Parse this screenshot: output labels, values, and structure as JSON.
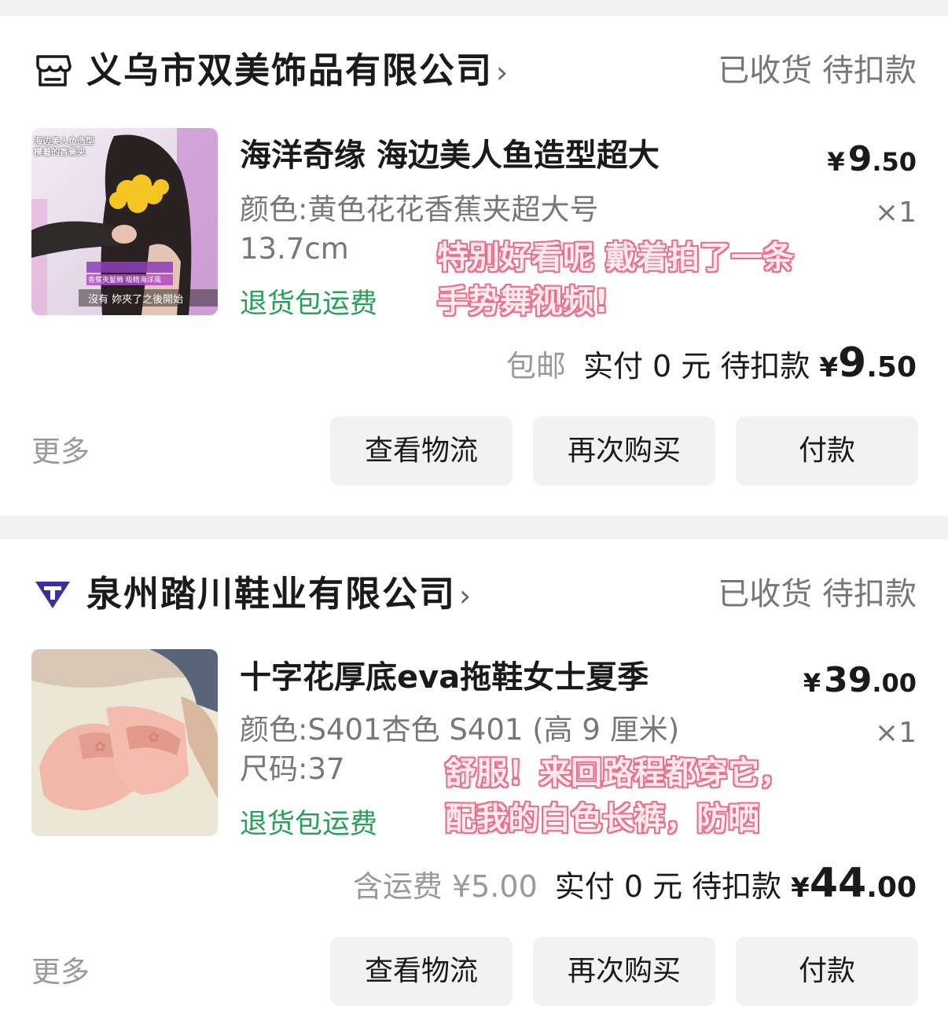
{
  "orders": [
    {
      "shop_name": "义乌市双美饰品有限公司",
      "shop_chevron": "›",
      "status": "已收货 待扣款",
      "product_title": "海洋奇缘 海边美人鱼造型超大",
      "price_currency": "¥",
      "price_int": "9",
      "price_dec": ".50",
      "spec_line1": "颜色:黄色花花香蕉夹超大号",
      "spec_line2": "13.7cm",
      "quantity": "×1",
      "refund_tag": "退货包运费",
      "thumb_caption_top1": "海边美人鱼造型",
      "thumb_caption_top2": "模着的香蕉夹",
      "thumb_caption_bottom": "沒有 妳夾了之後開始",
      "thumb_caption_mid": "香蕉夾髮飾 吸睛海洋風",
      "note_line1": "特别好看呢 戴着拍了一条",
      "note_line2": "手势舞视频!",
      "shipping_note": "包邮",
      "paid_label": "实付 0 元 待扣款",
      "total_currency": "¥",
      "total_int": "9",
      "total_dec": ".50",
      "more_label": "更多",
      "btn_logistics": "查看物流",
      "btn_rebuy": "再次购买",
      "btn_pay": "付款"
    },
    {
      "shop_name": "泉州踏川鞋业有限公司",
      "shop_chevron": "›",
      "status": "已收货 待扣款",
      "product_title": "十字花厚底eva拖鞋女士夏季",
      "price_currency": "¥",
      "price_int": "39",
      "price_dec": ".00",
      "spec_line1": "颜色:S401杏色 S401 (高 9 厘米)",
      "spec_line2": "尺码:37",
      "quantity": "×1",
      "refund_tag": "退货包运费",
      "note_line1": "舒服！来回路程都穿它，",
      "note_line2": "配我的白色长裤，防晒",
      "shipping_note": "含运费 ¥5.00",
      "paid_label": "实付 0 元 待扣款",
      "total_currency": "¥",
      "total_int": "44",
      "total_dec": ".00",
      "more_label": "更多",
      "btn_logistics": "查看物流",
      "btn_rebuy": "再次购买",
      "btn_pay": "付款"
    }
  ],
  "colors": {
    "background": "#f2f2f2",
    "refund_green": "#27a05a",
    "note_pink": "#e8708c",
    "shop2_icon": "#3b2e9e"
  },
  "icons": {
    "shop1": "store-icon",
    "shop2": "brand-logo-icon"
  }
}
